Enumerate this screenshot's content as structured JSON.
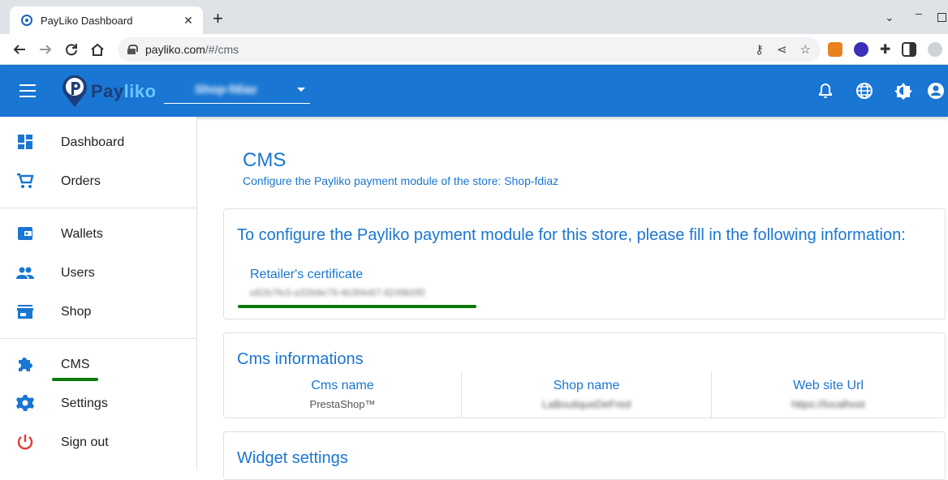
{
  "browser": {
    "tab_title": "PayLiko Dashboard",
    "url_host": "payliko.com",
    "url_path": "/#/cms"
  },
  "header": {
    "logo_text_a": "Pay",
    "logo_text_b": "liko",
    "shop_select_value": "Shop-fdiaz",
    "accent_color": "#1976d2"
  },
  "sidebar": {
    "items": [
      {
        "label": "Dashboard",
        "icon": "dashboard-icon"
      },
      {
        "label": "Orders",
        "icon": "cart-icon"
      },
      {
        "label": "Wallets",
        "icon": "wallet-icon"
      },
      {
        "label": "Users",
        "icon": "users-icon"
      },
      {
        "label": "Shop",
        "icon": "store-icon"
      },
      {
        "label": "CMS",
        "icon": "puzzle-icon"
      },
      {
        "label": "Settings",
        "icon": "gear-icon"
      },
      {
        "label": "Sign out",
        "icon": "power-icon"
      }
    ]
  },
  "main": {
    "title": "CMS",
    "subtitle": "Configure the Payliko payment module of the store: Shop-fdiaz",
    "config_card": {
      "title": "To configure the Payliko payment module for this store, please fill in the following information:",
      "cert_label": "Retailer's certificate",
      "cert_value": "e82b7fe3-a32b9e79-4b3f4e67-8249b5f0"
    },
    "info_card": {
      "title": "Cms informations",
      "columns": [
        {
          "header": "Cms name",
          "value": "PrestaShop™"
        },
        {
          "header": "Shop name",
          "value": "LaBoutiqueDeFred"
        },
        {
          "header": "Web site Url",
          "value": "https://localhost"
        }
      ]
    },
    "widget_card": {
      "title": "Widget settings"
    }
  }
}
